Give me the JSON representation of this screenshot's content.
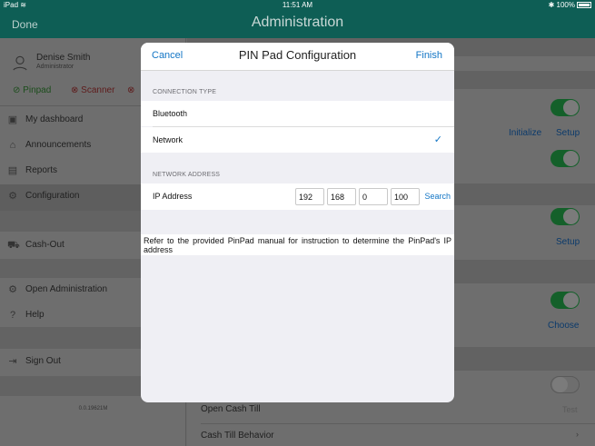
{
  "status_bar": {
    "device": "iPad",
    "time": "11:51 AM",
    "battery": "100%"
  },
  "navbar": {
    "done_label": "Done",
    "title": "Administration"
  },
  "sidebar": {
    "user": {
      "name": "Denise Smith",
      "role": "Administrator"
    },
    "statuses": [
      {
        "label": "Pinpad",
        "state": "ok"
      },
      {
        "label": "Scanner",
        "state": "error"
      },
      {
        "label": "",
        "state": "error"
      }
    ],
    "items": [
      {
        "label": "My dashboard",
        "icon": "dashboard-icon"
      },
      {
        "label": "Announcements",
        "icon": "announcements-icon"
      },
      {
        "label": "Reports",
        "icon": "reports-icon"
      },
      {
        "label": "Configuration",
        "icon": "configuration-icon"
      },
      {
        "label": "Cash-Out",
        "icon": "cash-out-icon"
      },
      {
        "label": "Open Administration",
        "icon": "gear-icon"
      },
      {
        "label": "Help",
        "icon": "help-icon"
      },
      {
        "label": "Sign Out",
        "icon": "sign-out-icon"
      }
    ],
    "version": "0.0.19621M"
  },
  "right_pane": {
    "initialize_label": "Initialize",
    "setup_label_1": "Setup",
    "setup_label_2": "Setup",
    "choose_label": "Choose",
    "open_cash_till": "Open Cash Till",
    "test_label": "Test",
    "cash_till_behavior": "Cash Till Behavior"
  },
  "modal": {
    "cancel_label": "Cancel",
    "title": "PIN Pad Configuration",
    "finish_label": "Finish",
    "connection_header": "CONNECTION TYPE",
    "connection_options": [
      {
        "label": "Bluetooth",
        "selected": false
      },
      {
        "label": "Network",
        "selected": true
      }
    ],
    "check_glyph": "✓",
    "network_header": "NETWORK ADDRESS",
    "ip_label": "IP Address",
    "ip_octets": [
      "192",
      "168",
      "0",
      "100"
    ],
    "search_label": "Search",
    "note": "Refer to the provided PinPad manual for instruction to determine the PinPad's IP address"
  },
  "colors": {
    "accent": "#1275c5",
    "nav": "#0e5e55",
    "toggle_on": "#34c759"
  }
}
